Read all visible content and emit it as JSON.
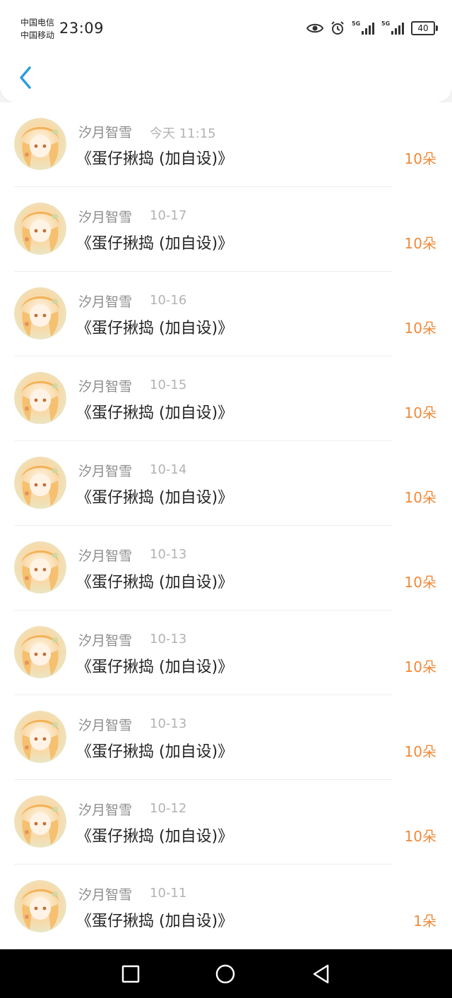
{
  "status_bar": {
    "carrier_1": "中国电信",
    "carrier_2": "中国移动",
    "time": "23:09",
    "signal_1_tag": "5G",
    "signal_2_tag": "5G",
    "battery": "40",
    "icons": [
      "eye-icon",
      "alarm-icon",
      "signal-icon",
      "signal-icon",
      "battery-icon"
    ]
  },
  "header": {
    "back_icon": "chevron-left-icon",
    "accent_color": "#2d9cdb"
  },
  "colors": {
    "amount": "#f08a3a",
    "name": "#8c8c8c",
    "time": "#b3b3b3",
    "title": "#222222"
  },
  "records": [
    {
      "name": "汐月智雪",
      "time": "今天 11:15",
      "title": "《蛋仔揪捣 (加自设)》",
      "amount": "10朵"
    },
    {
      "name": "汐月智雪",
      "time": "10-17",
      "title": "《蛋仔揪捣 (加自设)》",
      "amount": "10朵"
    },
    {
      "name": "汐月智雪",
      "time": "10-16",
      "title": "《蛋仔揪捣 (加自设)》",
      "amount": "10朵"
    },
    {
      "name": "汐月智雪",
      "time": "10-15",
      "title": "《蛋仔揪捣 (加自设)》",
      "amount": "10朵"
    },
    {
      "name": "汐月智雪",
      "time": "10-14",
      "title": "《蛋仔揪捣 (加自设)》",
      "amount": "10朵"
    },
    {
      "name": "汐月智雪",
      "time": "10-13",
      "title": "《蛋仔揪捣 (加自设)》",
      "amount": "10朵"
    },
    {
      "name": "汐月智雪",
      "time": "10-13",
      "title": "《蛋仔揪捣 (加自设)》",
      "amount": "10朵"
    },
    {
      "name": "汐月智雪",
      "time": "10-13",
      "title": "《蛋仔揪捣 (加自设)》",
      "amount": "10朵"
    },
    {
      "name": "汐月智雪",
      "time": "10-12",
      "title": "《蛋仔揪捣 (加自设)》",
      "amount": "10朵"
    },
    {
      "name": "汐月智雪",
      "time": "10-11",
      "title": "《蛋仔揪捣 (加自设)》",
      "amount": "1朵"
    }
  ],
  "nav_bar": {
    "icons": [
      "square-recent-icon",
      "circle-home-icon",
      "triangle-back-icon"
    ]
  }
}
